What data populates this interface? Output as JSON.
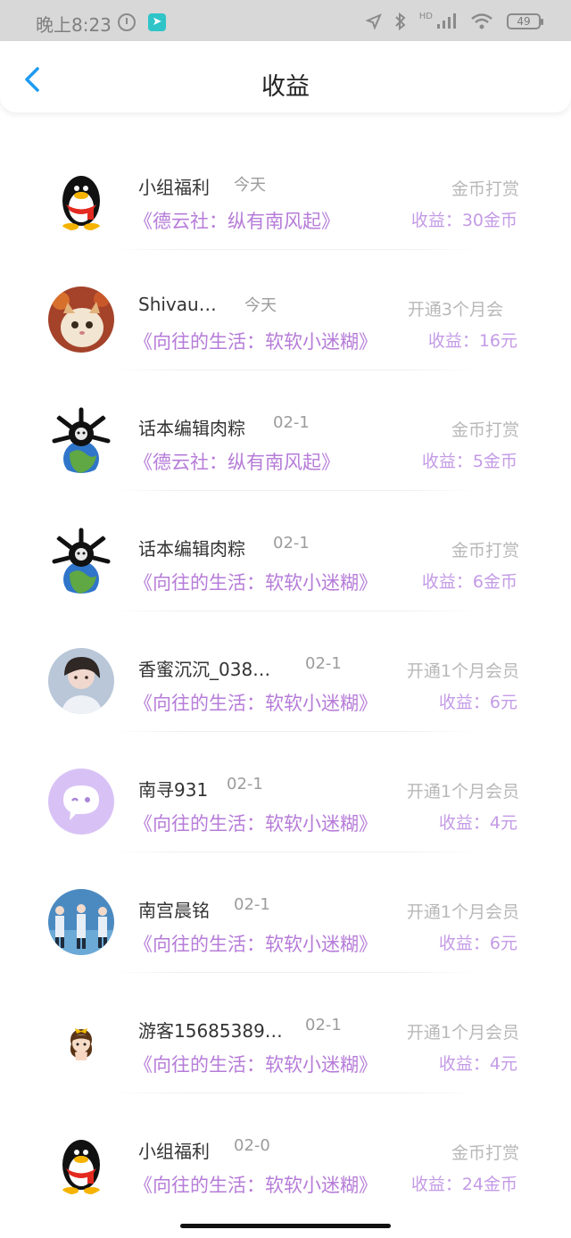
{
  "status_bar": {
    "time": "晚上8:23",
    "app_icon_glyph": "➤",
    "network": "HD",
    "battery": "49"
  },
  "header": {
    "title": "收益"
  },
  "entries": [
    {
      "name": "小组福利",
      "date": "今天",
      "book": "《德云社：纵有南风起》",
      "type": "金币打赏",
      "income": "收益：30金币"
    },
    {
      "name": "Shivau…",
      "date": "今天",
      "book": "《向往的生活：软软小迷糊》",
      "type": "开通3个月会",
      "income": "收益：16元"
    },
    {
      "name": "话本编辑肉粽",
      "date": "02-1",
      "book": "《德云社：纵有南风起》",
      "type": "金币打赏",
      "income": "收益：5金币"
    },
    {
      "name": "话本编辑肉粽",
      "date": "02-1",
      "book": "《向往的生活：软软小迷糊》",
      "type": "金币打赏",
      "income": "收益：6金币"
    },
    {
      "name": "香蜜沉沉_038…",
      "date": "02-1",
      "book": "《向往的生活：软软小迷糊》",
      "type": "开通1个月会员",
      "income": "收益：6元"
    },
    {
      "name": "南寻931",
      "date": "02-1",
      "book": "《向往的生活：软软小迷糊》",
      "type": "开通1个月会员",
      "income": "收益：4元"
    },
    {
      "name": "南宫晨铭",
      "date": "02-1",
      "book": "《向往的生活：软软小迷糊》",
      "type": "开通1个月会员",
      "income": "收益：6元"
    },
    {
      "name": "游客15685389…",
      "date": "02-1",
      "book": "《向往的生活：软软小迷糊》",
      "type": "开通1个月会员",
      "income": "收益：4元"
    },
    {
      "name": "小组福利",
      "date": "02-0",
      "book": "《向往的生活：软软小迷糊》",
      "type": "金币打赏",
      "income": "收益：24金币"
    }
  ],
  "colors": {
    "accent": "#1e9bf0",
    "book_title": "#b67cd8",
    "income": "#c49be6",
    "muted": "#b8b8b8"
  }
}
